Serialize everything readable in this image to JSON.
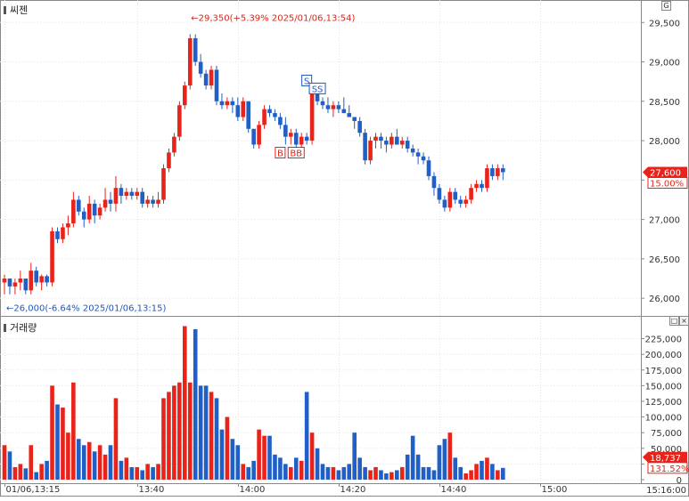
{
  "chart_data": {
    "type": "candlestick",
    "price_panel": {
      "title": "씨젠",
      "ylim": [
        25900,
        29650
      ],
      "ticks": [
        26000,
        26500,
        27000,
        27500,
        28000,
        28500,
        29000,
        29500
      ],
      "tick_labels": [
        "26,000",
        "26,500",
        "27,000",
        "27,500",
        "28,000",
        "28,500",
        "29,000",
        "29,500"
      ],
      "current_price": "27,600",
      "current_change": "15.00%",
      "high_annotation": "←29,350(+5.39% 2025/01/06,13:54)",
      "low_annotation": "←26,000(-6.64% 2025/01/06,13:15)",
      "signals": [
        {
          "label": "B",
          "idx": 52,
          "price": 27950
        },
        {
          "label": "BB",
          "idx": 55,
          "price": 27950
        },
        {
          "label": "S",
          "idx": 57,
          "price": 28650
        },
        {
          "label": "SS",
          "idx": 59,
          "price": 28550
        }
      ],
      "ohlc": [
        [
          26200,
          26300,
          26050,
          26250
        ],
        [
          26250,
          26250,
          26050,
          26150
        ],
        [
          26150,
          26250,
          26050,
          26200
        ],
        [
          26200,
          26350,
          26100,
          26250
        ],
        [
          26250,
          26250,
          26050,
          26100
        ],
        [
          26100,
          26450,
          26050,
          26350
        ],
        [
          26350,
          26400,
          26150,
          26200
        ],
        [
          26200,
          26300,
          26100,
          26280
        ],
        [
          26280,
          26300,
          26150,
          26200
        ],
        [
          26200,
          26900,
          26150,
          26850
        ],
        [
          26850,
          26900,
          26700,
          26750
        ],
        [
          26750,
          26950,
          26700,
          26900
        ],
        [
          26900,
          27050,
          26800,
          26950
        ],
        [
          26950,
          27350,
          26900,
          27250
        ],
        [
          27250,
          27300,
          27050,
          27100
        ],
        [
          27100,
          27150,
          26900,
          27000
        ],
        [
          27000,
          27300,
          26950,
          27200
        ],
        [
          27200,
          27250,
          26950,
          27050
        ],
        [
          27050,
          27200,
          27000,
          27150
        ],
        [
          27150,
          27400,
          27100,
          27250
        ],
        [
          27250,
          27350,
          27100,
          27200
        ],
        [
          27200,
          27550,
          27100,
          27400
        ],
        [
          27400,
          27450,
          27200,
          27300
        ],
        [
          27300,
          27400,
          27250,
          27350
        ],
        [
          27350,
          27400,
          27250,
          27300
        ],
        [
          27300,
          27400,
          27250,
          27350
        ],
        [
          27350,
          27400,
          27150,
          27200
        ],
        [
          27200,
          27300,
          27150,
          27250
        ],
        [
          27250,
          27300,
          27150,
          27200
        ],
        [
          27200,
          27350,
          27150,
          27250
        ],
        [
          27250,
          27700,
          27200,
          27650
        ],
        [
          27650,
          27900,
          27600,
          27850
        ],
        [
          27850,
          28100,
          27800,
          28050
        ],
        [
          28050,
          28500,
          28000,
          28450
        ],
        [
          28450,
          28750,
          28400,
          28700
        ],
        [
          28700,
          29350,
          28650,
          29300
        ],
        [
          29300,
          29350,
          28950,
          29000
        ],
        [
          29000,
          29100,
          28800,
          28850
        ],
        [
          28850,
          28900,
          28650,
          28700
        ],
        [
          28700,
          28950,
          28650,
          28900
        ],
        [
          28900,
          28950,
          28450,
          28500
        ],
        [
          28500,
          28600,
          28400,
          28450
        ],
        [
          28450,
          28550,
          28400,
          28500
        ],
        [
          28500,
          28550,
          28350,
          28450
        ],
        [
          28450,
          28550,
          28250,
          28300
        ],
        [
          28300,
          28550,
          28250,
          28500
        ],
        [
          28500,
          28500,
          28100,
          28150
        ],
        [
          28150,
          28150,
          27900,
          27950
        ],
        [
          27950,
          28250,
          27900,
          28200
        ],
        [
          28200,
          28450,
          28150,
          28400
        ],
        [
          28400,
          28450,
          28300,
          28350
        ],
        [
          28350,
          28400,
          28250,
          28300
        ],
        [
          28300,
          28350,
          28150,
          28200
        ],
        [
          28200,
          28300,
          27950,
          28050
        ],
        [
          28050,
          28150,
          27950,
          28100
        ],
        [
          28100,
          28150,
          27900,
          27950
        ],
        [
          27950,
          28100,
          27900,
          28050
        ],
        [
          28050,
          28100,
          27950,
          28000
        ],
        [
          28000,
          28650,
          27950,
          28600
        ],
        [
          28600,
          28650,
          28450,
          28500
        ],
        [
          28500,
          28550,
          28400,
          28450
        ],
        [
          28450,
          28550,
          28350,
          28400
        ],
        [
          28400,
          28500,
          28300,
          28450
        ],
        [
          28450,
          28500,
          28350,
          28400
        ],
        [
          28400,
          28550,
          28350,
          28350
        ],
        [
          28350,
          28450,
          28300,
          28300
        ],
        [
          28300,
          28300,
          28150,
          28250
        ],
        [
          28250,
          28300,
          28050,
          28100
        ],
        [
          28100,
          28150,
          27700,
          27750
        ],
        [
          27750,
          28050,
          27700,
          28000
        ],
        [
          28000,
          28100,
          27900,
          28050
        ],
        [
          28050,
          28100,
          27900,
          28000
        ],
        [
          28000,
          28050,
          27850,
          27950
        ],
        [
          27950,
          28100,
          27900,
          28050
        ],
        [
          28050,
          28150,
          27950,
          27950
        ],
        [
          27950,
          28050,
          27900,
          28000
        ],
        [
          28000,
          28050,
          27850,
          27900
        ],
        [
          27900,
          27950,
          27800,
          27850
        ],
        [
          27850,
          27900,
          27700,
          27800
        ],
        [
          27800,
          27850,
          27700,
          27750
        ],
        [
          27750,
          27800,
          27500,
          27550
        ],
        [
          27550,
          27600,
          27300,
          27400
        ],
        [
          27400,
          27450,
          27200,
          27250
        ],
        [
          27250,
          27300,
          27100,
          27150
        ],
        [
          27150,
          27400,
          27100,
          27350
        ],
        [
          27350,
          27400,
          27200,
          27250
        ],
        [
          27250,
          27300,
          27150,
          27200
        ],
        [
          27200,
          27300,
          27150,
          27250
        ],
        [
          27250,
          27450,
          27200,
          27400
        ],
        [
          27400,
          27500,
          27350,
          27450
        ],
        [
          27450,
          27500,
          27350,
          27400
        ],
        [
          27400,
          27700,
          27350,
          27650
        ],
        [
          27650,
          27700,
          27500,
          27550
        ],
        [
          27550,
          27700,
          27500,
          27650
        ],
        [
          27650,
          27700,
          27500,
          27600
        ]
      ]
    },
    "volume_panel": {
      "title": "거래량",
      "ylim": [
        0,
        240000
      ],
      "ticks": [
        0,
        25000,
        50000,
        75000,
        100000,
        125000,
        150000,
        175000,
        200000,
        225000
      ],
      "tick_labels": [
        "0",
        "25,000",
        "50,000",
        "75,000",
        "100,000",
        "125,000",
        "150,000",
        "175,000",
        "200,000",
        "225,000"
      ],
      "current_volume": "18,737",
      "current_ratio": "131.52%",
      "values": [
        55000,
        45000,
        20000,
        25000,
        18000,
        55000,
        12000,
        25000,
        30000,
        150000,
        120000,
        115000,
        75000,
        155000,
        65000,
        55000,
        60000,
        45000,
        55000,
        40000,
        55000,
        130000,
        30000,
        35000,
        20000,
        20000,
        15000,
        25000,
        20000,
        25000,
        130000,
        140000,
        150000,
        155000,
        245000,
        155000,
        240000,
        150000,
        150000,
        140000,
        130000,
        80000,
        100000,
        65000,
        55000,
        25000,
        20000,
        30000,
        80000,
        70000,
        70000,
        40000,
        35000,
        25000,
        20000,
        35000,
        30000,
        140000,
        75000,
        50000,
        25000,
        20000,
        20000,
        15000,
        20000,
        25000,
        75000,
        35000,
        20000,
        15000,
        20000,
        15000,
        10000,
        12000,
        15000,
        20000,
        40000,
        70000,
        40000,
        20000,
        20000,
        15000,
        55000,
        65000,
        75000,
        35000,
        20000,
        10000,
        15000,
        25000,
        30000,
        35000,
        25000,
        15000,
        18737
      ]
    },
    "x_axis": {
      "tick_labels": [
        "01/06,13:15",
        "13:40",
        "14:00",
        "14:20",
        "14:40",
        "15:00"
      ],
      "tick_index": [
        0,
        25,
        44,
        63,
        82,
        101
      ],
      "right_label": "15:16:00"
    }
  },
  "colors": {
    "up": "#e8231a",
    "down": "#1f5fc6",
    "flat": "#3a9a3a",
    "grid": "#e3e3e3",
    "high_text": "#d8261c",
    "low_text": "#2356b8"
  },
  "ui": {
    "price_pane_btn": "G",
    "volume_pane_btns": [
      "□",
      "×"
    ]
  }
}
